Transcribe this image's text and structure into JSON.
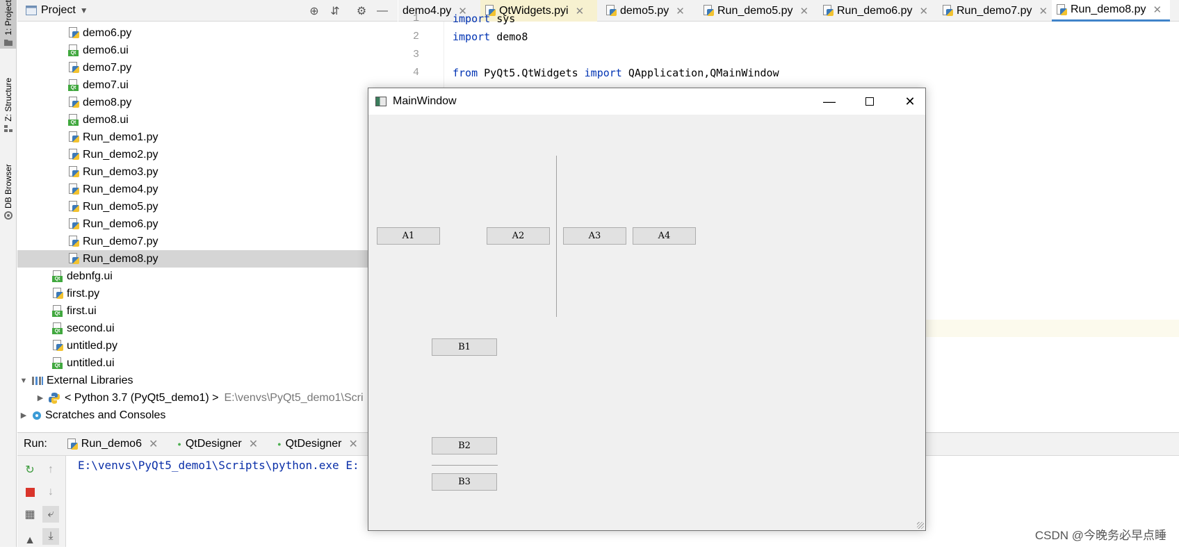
{
  "sidebar_tabs": [
    {
      "label": "1: Project",
      "icon": "folder-icon"
    },
    {
      "label": "Z: Structure",
      "icon": "structure-icon"
    },
    {
      "label": "DB Browser",
      "icon": "db-browser-icon"
    }
  ],
  "project_panel": {
    "title": "Project",
    "files": [
      {
        "name": "demo6.py",
        "type": "py"
      },
      {
        "name": "demo6.ui",
        "type": "ui"
      },
      {
        "name": "demo7.py",
        "type": "py"
      },
      {
        "name": "demo7.ui",
        "type": "ui"
      },
      {
        "name": "demo8.py",
        "type": "py"
      },
      {
        "name": "demo8.ui",
        "type": "ui"
      },
      {
        "name": "Run_demo1.py",
        "type": "py"
      },
      {
        "name": "Run_demo2.py",
        "type": "py"
      },
      {
        "name": "Run_demo3.py",
        "type": "py"
      },
      {
        "name": "Run_demo4.py",
        "type": "py"
      },
      {
        "name": "Run_demo5.py",
        "type": "py"
      },
      {
        "name": "Run_demo6.py",
        "type": "py"
      },
      {
        "name": "Run_demo7.py",
        "type": "py"
      },
      {
        "name": "Run_demo8.py",
        "type": "py",
        "selected": true
      }
    ],
    "root_files": [
      {
        "name": "debnfg.ui",
        "type": "ui"
      },
      {
        "name": "first.py",
        "type": "py"
      },
      {
        "name": "first.ui",
        "type": "ui"
      },
      {
        "name": "second.ui",
        "type": "ui"
      },
      {
        "name": "untitled.py",
        "type": "py"
      },
      {
        "name": "untitled.ui",
        "type": "ui"
      }
    ],
    "external_libraries": "External Libraries",
    "python_interpreter": "< Python 3.7 (PyQt5_demo1) >",
    "python_path": "E:\\venvs\\PyQt5_demo1\\Scri",
    "scratches": "Scratches and Consoles"
  },
  "editor_tabs": [
    {
      "label": "demo4.py"
    },
    {
      "label": "QtWidgets.pyi",
      "highlight": true
    },
    {
      "label": "demo5.py"
    },
    {
      "label": "Run_demo5.py"
    },
    {
      "label": "Run_demo6.py"
    },
    {
      "label": "Run_demo7.py"
    },
    {
      "label": "Run_demo8.py",
      "active": true
    }
  ],
  "code_lines": [
    {
      "num": "1",
      "kw": "import",
      "rest": " sys"
    },
    {
      "num": "2",
      "kw": "import",
      "rest": " demo8"
    },
    {
      "num": "3",
      "kw": "",
      "rest": ""
    },
    {
      "num": "4",
      "kw": "from",
      "rest": " PyQt5.QtWidgets ",
      "kw2": "import",
      "rest2": " QApplication,QMainWindow"
    }
  ],
  "run_panel": {
    "label": "Run:",
    "tabs": [
      "Run_demo6",
      "QtDesigner",
      "QtDesigner"
    ],
    "console_text": "E:\\venvs\\PyQt5_demo1\\Scripts\\python.exe E:"
  },
  "main_window": {
    "title": "MainWindow",
    "buttons": {
      "a1": "A1",
      "a2": "A2",
      "a3": "A3",
      "a4": "A4",
      "b1": "B1",
      "b2": "B2",
      "b3": "B3"
    }
  },
  "watermark": "CSDN @今晚务必早点睡"
}
